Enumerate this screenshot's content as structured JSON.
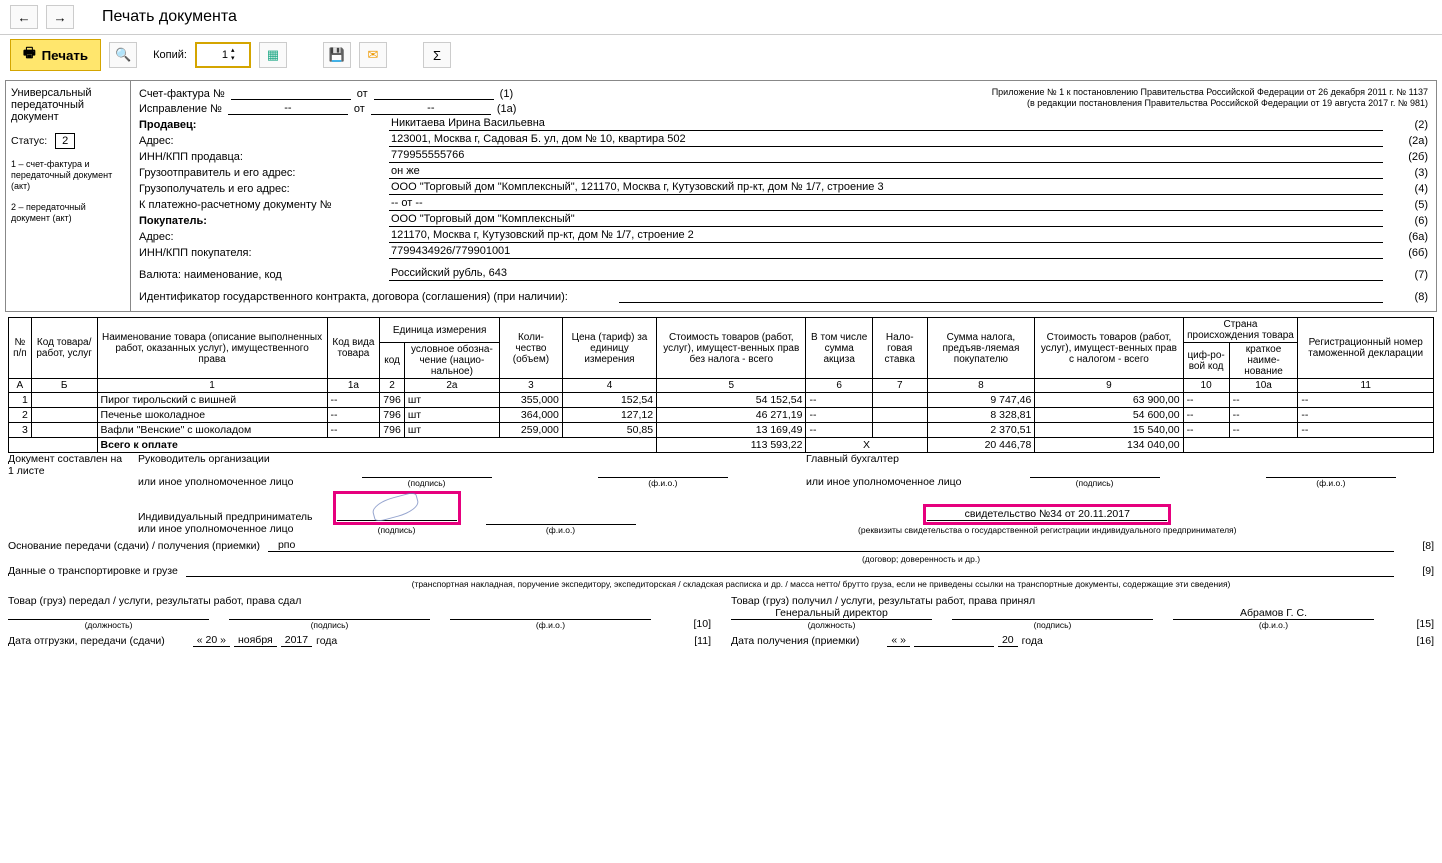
{
  "header": {
    "title": "Печать документа",
    "print_btn": "Печать",
    "copies_label": "Копий:",
    "copies_value": "1"
  },
  "sidebar": {
    "l1": "Универсальный",
    "l2": "передаточный",
    "l3": "документ",
    "status_label": "Статус:",
    "status_value": "2",
    "note1": "1 – счет-фактура и передаточный документ (акт)",
    "note2": "2 – передаточный документ (акт)"
  },
  "legal": {
    "l1": "Приложение № 1 к постановлению Правительства Российской Федерации от 26 декабря 2011 г. № 1137",
    "l2": "(в редакции постановления Правительства Российской Федерации от 19 августа 2017 г. № 981)"
  },
  "invoice": {
    "sf_label": "Счет-фактура №",
    "from": "от",
    "code1": "(1)",
    "fix_label": "Исправление №",
    "dash": "--",
    "code1a": "(1а)",
    "seller_label": "Продавец:",
    "seller": "Никитаева Ирина Васильевна",
    "c2": "(2)",
    "addr_label": "Адрес:",
    "seller_addr": "123001, Москва г, Садовая Б. ул, дом № 10, квартира 502",
    "c2a": "(2а)",
    "inn_label": "ИНН/КПП продавца:",
    "seller_inn": "779955555766",
    "c2b": "(2б)",
    "shipper_label": "Грузоотправитель и его адрес:",
    "shipper": "он же",
    "c3": "(3)",
    "consignee_label": "Грузополучатель и его адрес:",
    "consignee": "ООО \"Торговый дом \"Комплексный\", 121170, Москва г, Кутузовский пр-кт, дом № 1/7, строение 3",
    "c4": "(4)",
    "paydoc_label": "К платежно-расчетному документу №",
    "paydoc": "-- от --",
    "c5": "(5)",
    "buyer_label": "Покупатель:",
    "buyer": "ООО \"Торговый дом \"Комплексный\"",
    "c6": "(6)",
    "buyer_addr": "121170, Москва г, Кутузовский пр-кт, дом № 1/7, строение 2",
    "c6a": "(6а)",
    "buyer_inn_label": "ИНН/КПП покупателя:",
    "buyer_inn": "7799434926/779901001",
    "c6b": "(6б)",
    "currency_label": "Валюта: наименование, код",
    "currency": "Российский рубль, 643",
    "c7": "(7)",
    "contract_label": "Идентификатор государственного контракта, договора (соглашения) (при наличии):",
    "c8": "(8)"
  },
  "table": {
    "headers": {
      "no": "№ п/п",
      "code_goods": "Код товара/ работ, услуг",
      "name": "Наименование товара (описание выполненных работ, оказанных услуг), имущественного права",
      "type_code": "Код вида товара",
      "unit": "Единица измерения",
      "unit_code": "код",
      "unit_name": "условное обозна-чение (нацио-нальное)",
      "qty": "Коли-чество (объем)",
      "price": "Цена (тариф) за единицу измерения",
      "cost": "Стоимость товаров (работ, услуг), имущест-венных прав без налога - всего",
      "excise": "В том числе сумма акциза",
      "tax_rate": "Нало-говая ставка",
      "tax_sum": "Сумма налога, предъяв-ляемая покупателю",
      "total": "Стоимость товаров (работ, услуг), имущест-венных прав с налогом - всего",
      "country": "Страна происхождения товара",
      "country_code": "циф-ро-вой код",
      "country_name": "краткое наиме-нование",
      "decl": "Регистрационный номер таможенной декларации"
    },
    "col_labels": {
      "a": "А",
      "b": "Б",
      "n1": "1",
      "n1a": "1а",
      "n2": "2",
      "n2a": "2а",
      "n3": "3",
      "n4": "4",
      "n5": "5",
      "n6": "6",
      "n7": "7",
      "n8": "8",
      "n9": "9",
      "n10": "10",
      "n10a": "10а",
      "n11": "11"
    },
    "rows": [
      {
        "n": "1",
        "name": "Пирог тирольский с вишней",
        "tc": "--",
        "uc": "796",
        "un": "шт",
        "qty": "355,000",
        "price": "152,54",
        "cost": "54 152,54",
        "exc": "--",
        "rate": "",
        "tax": "9 747,46",
        "tot": "63 900,00",
        "cc": "--",
        "cn": "--",
        "dec": "--"
      },
      {
        "n": "2",
        "name": "Печенье шоколадное",
        "tc": "--",
        "uc": "796",
        "un": "шт",
        "qty": "364,000",
        "price": "127,12",
        "cost": "46 271,19",
        "exc": "--",
        "rate": "",
        "tax": "8 328,81",
        "tot": "54 600,00",
        "cc": "--",
        "cn": "--",
        "dec": "--"
      },
      {
        "n": "3",
        "name": "Вафли \"Венские\" с шоколадом",
        "tc": "--",
        "uc": "796",
        "un": "шт",
        "qty": "259,000",
        "price": "50,85",
        "cost": "13 169,49",
        "exc": "--",
        "rate": "",
        "tax": "2 370,51",
        "tot": "15 540,00",
        "cc": "--",
        "cn": "--",
        "dec": "--"
      }
    ],
    "total_label": "Всего к оплате",
    "total_cost": "113 593,22",
    "total_x": "Х",
    "total_tax": "20 446,78",
    "total_all": "134 040,00"
  },
  "sig": {
    "doc_composed": "Документ составлен на",
    "pages": "1 листе",
    "head_org": "Руководитель организации",
    "or_auth": "или иное уполномоченное лицо",
    "chief_acc": "Главный бухгалтер",
    "ip": "Индивидуальный предприниматель",
    "podpis": "(подпись)",
    "fio": "(ф.и.о.)",
    "cert": "свидетельство №34 от 20.11.2017",
    "cert_note": "(реквизиты свидетельства о государственной регистрации индивидуального предпринимателя)"
  },
  "bottom": {
    "base_label": "Основание передачи (сдачи) / получения (приемки)",
    "base_val": "рпо",
    "base_note": "(договор; доверенность и др.)",
    "c8": "[8]",
    "transport_label": "Данные о транспортировке и грузе",
    "transport_note": "(транспортная накладная, поручение экспедитору, экспедиторская / складская расписка и др. / масса нетто/ брутто груза, если не приведены ссылки на транспортные документы, содержащие эти сведения)",
    "c9": "[9]",
    "gave_label": "Товар (груз) передал / услуги, результаты работ, права сдал",
    "c10": "[10]",
    "got_label": "Товар (груз) получил / услуги, результаты работ, права принял",
    "c15": "[15]",
    "position": "(должность)",
    "gen_dir": "Генеральный директор",
    "abramov": "Абрамов Г. С.",
    "ship_date_label": "Дата отгрузки, передачи (сдачи)",
    "recv_date_label": "Дата получения (приемки)",
    "d_day": "« 20 »",
    "d_month": "ноября",
    "d_year": "2017",
    "d_y": "года",
    "d_day2": "«       »",
    "d_year2": "20",
    "c11": "[11]",
    "c16": "[16]"
  }
}
